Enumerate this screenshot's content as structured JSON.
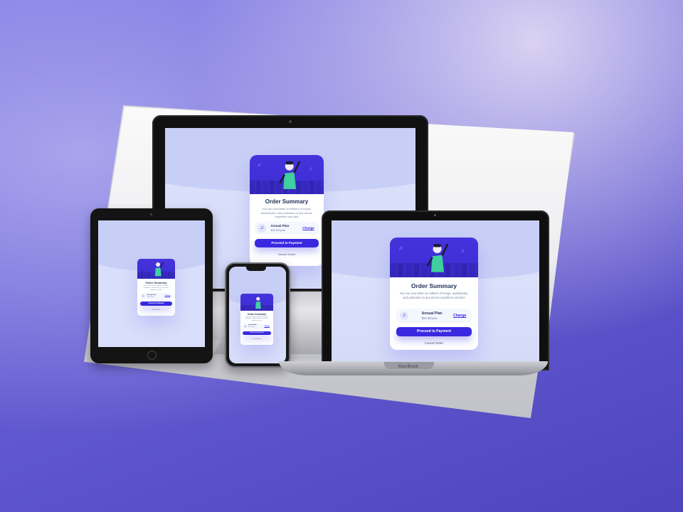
{
  "colors": {
    "background": "#6a63d8",
    "accent": "#3829e0",
    "card_hero": "#4532dc",
    "title_text": "#1f2f56",
    "muted_text": "#717fa6",
    "plan_bg": "#f5f7ff"
  },
  "order_card": {
    "title": "Order Summary",
    "description": "You can now listen to millions of songs, audiobooks, and podcasts on any device anywhere you like!",
    "plan_icon": "music-note-icon",
    "plan_glyph": "♫",
    "plan_name": "Annual Plan",
    "plan_price": "$59.99/year",
    "change_label": "Change",
    "pay_label": "Proceed to Payment",
    "cancel_label": "Cancel Order"
  },
  "laptop": {
    "brand": "MacBook"
  }
}
